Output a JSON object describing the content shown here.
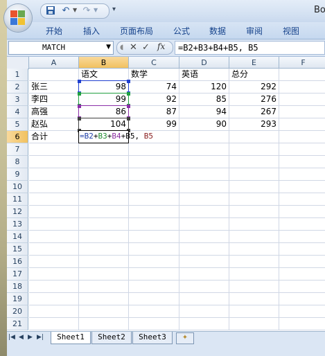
{
  "window": {
    "title": "Bool"
  },
  "quick_access": {
    "save_icon": "save-icon",
    "undo_icon": "undo-icon",
    "redo_icon": "redo-icon",
    "customize_icon": "customize-qat-icon"
  },
  "ribbon": {
    "tabs": [
      "开始",
      "插入",
      "页面布局",
      "公式",
      "数据",
      "审阅",
      "视图"
    ]
  },
  "formula_bar": {
    "name_box": "MATCH",
    "cancel": "✕",
    "enter": "✓",
    "fx": "fx",
    "formula": "=B2+B3+B4+B5, B5"
  },
  "columns": [
    "A",
    "B",
    "C",
    "D",
    "E",
    "F"
  ],
  "rows": [
    "1",
    "2",
    "3",
    "4",
    "5",
    "6",
    "7",
    "8",
    "9",
    "10",
    "11",
    "12",
    "13",
    "14",
    "15",
    "16",
    "17",
    "18",
    "19",
    "20",
    "21"
  ],
  "cells": {
    "B1": "语文",
    "C1": "数学",
    "D1": "英语",
    "E1": "总分",
    "A2": "张三",
    "B2": "98",
    "C2": "74",
    "D2": "120",
    "E2": "292",
    "A3": "李四",
    "B3": "99",
    "C3": "92",
    "D3": "85",
    "E3": "276",
    "A4": "高强",
    "B4": "86",
    "C4": "87",
    "D4": "94",
    "E4": "267",
    "A5": "赵弘",
    "B5": "104",
    "C5": "99",
    "D5": "90",
    "E5": "293",
    "A6": "合计"
  },
  "editing_cell": {
    "ref": "B6",
    "parts": [
      {
        "text": "=B2",
        "color": "#1f3fa8"
      },
      {
        "text": "+",
        "color": "#000000"
      },
      {
        "text": "B3",
        "color": "#1e8a2e"
      },
      {
        "text": "+",
        "color": "#000000"
      },
      {
        "text": "B4",
        "color": "#8a2e9e"
      },
      {
        "text": "+B5, ",
        "color": "#000000"
      },
      {
        "text": "B5",
        "color": "#8a2020"
      }
    ]
  },
  "range_colors": {
    "B2": "#2040d0",
    "B3": "#20a040",
    "B4": "#8a2ea8",
    "B5": "#404040"
  },
  "sheets": [
    "Sheet1",
    "Sheet2",
    "Sheet3"
  ],
  "active_sheet": "Sheet1"
}
